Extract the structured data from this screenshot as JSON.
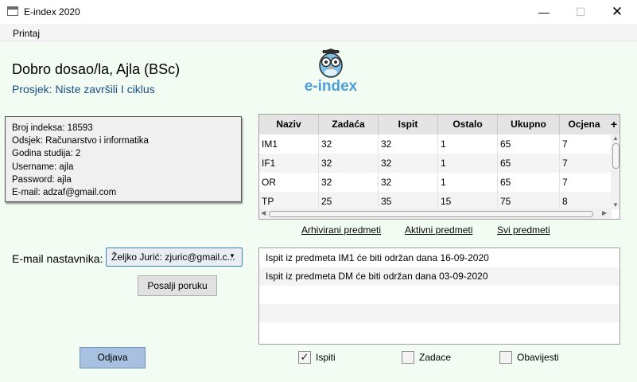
{
  "window": {
    "title": "E-index 2020"
  },
  "menu": {
    "items": [
      "Printaj"
    ]
  },
  "header": {
    "welcome": "Dobro dosao/la, Ajla (BSc)",
    "average": "Prosjek: Niste završili I ciklus",
    "logo_text": "e-index",
    "accent_color": "#4f9ed8"
  },
  "student": {
    "index": "Broj indeksa: 18593",
    "department": "Odsjek: Računarstvo i informatika",
    "year": "Godina studija: 2",
    "username": "Username: ajla",
    "password": "Password: ajla",
    "email": "E-mail: adzaf@gmail.com"
  },
  "grades": {
    "columns": [
      "Naziv",
      "Zadaća",
      "Ispit",
      "Ostalo",
      "Ukupno",
      "Ocjena"
    ],
    "add_symbol": "+",
    "rows": [
      [
        "IM1",
        "32",
        "32",
        "1",
        "65",
        "7"
      ],
      [
        "IF1",
        "32",
        "32",
        "1",
        "65",
        "7"
      ],
      [
        "OR",
        "32",
        "32",
        "1",
        "65",
        "7"
      ],
      [
        "TP",
        "25",
        "35",
        "15",
        "75",
        "8"
      ]
    ]
  },
  "links": {
    "archived": "Arhivirani predmeti",
    "active": "Aktivni predmeti",
    "all": "Svi predmeti"
  },
  "contact": {
    "label": "E-mail nastavnika:",
    "selected": "Željko Jurić: zjuric@gmail.c...",
    "send_label": "Posalji poruku"
  },
  "notifications": [
    "Ispit iz predmeta IM1 će biti održan dana 16-09-2020",
    "Ispit iz predmeta DM će biti održan dana 03-09-2020"
  ],
  "logout_label": "Odjava",
  "filters": [
    {
      "label": "Ispiti",
      "checked": true
    },
    {
      "label": "Zadace",
      "checked": false
    },
    {
      "label": "Obavijesti",
      "checked": false
    }
  ]
}
